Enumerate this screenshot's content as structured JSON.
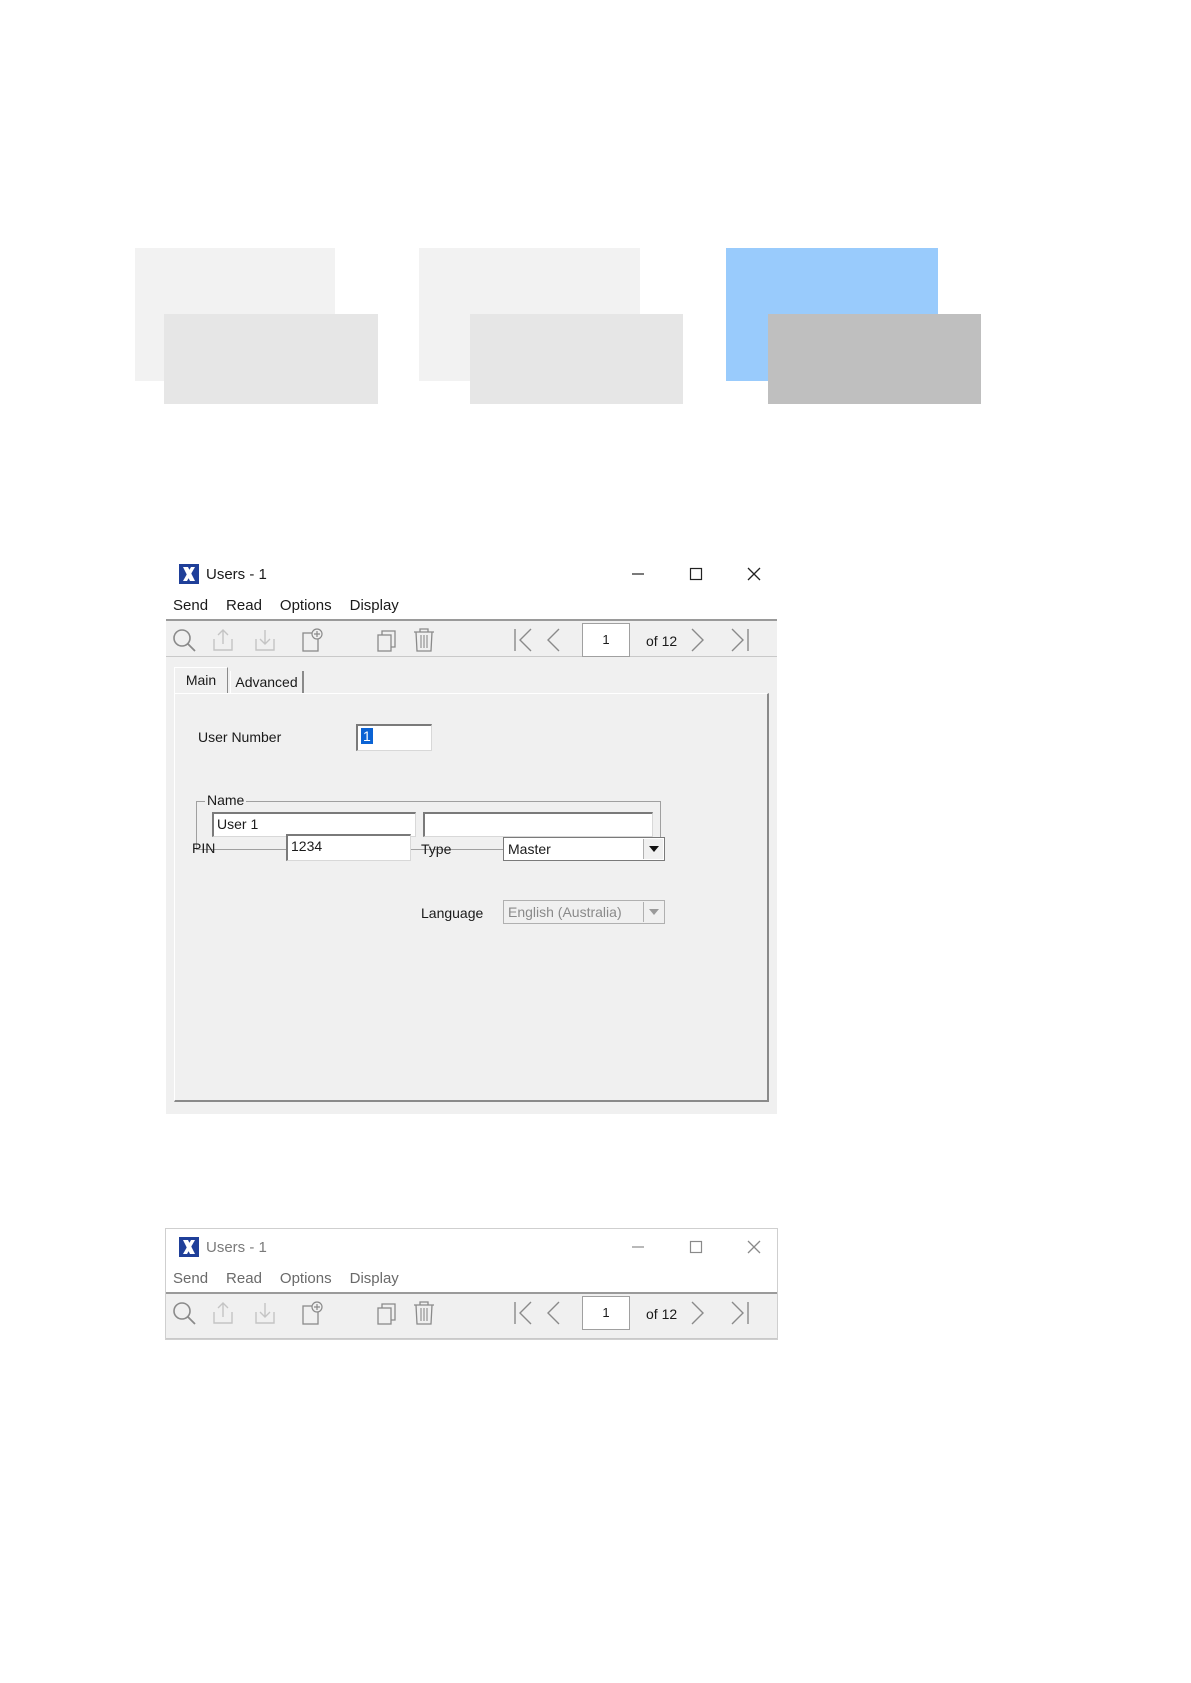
{
  "window": {
    "title": "Users - 1",
    "menu": [
      "Send",
      "Read",
      "Options",
      "Display"
    ],
    "pager": {
      "current": "1",
      "of_label": "of 12"
    }
  },
  "tabs": {
    "main": "Main",
    "advanced": "Advanced"
  },
  "form": {
    "user_number_label": "User Number",
    "user_number_value": "1",
    "name_group_label": "Name",
    "name_first": "User 1",
    "name_second": "",
    "pin_label": "PIN",
    "pin_value": "1234",
    "type_label": "Type",
    "type_value": "Master",
    "language_label": "Language",
    "language_value": "English (Australia)"
  },
  "icons": {
    "search": "search-icon",
    "upload": "send-icon",
    "download": "read-icon",
    "new": "new-record-icon",
    "copy": "copy-icon",
    "delete": "trash-icon",
    "first": "first-page-icon",
    "prev": "prev-page-icon",
    "next": "next-page-icon",
    "last": "last-page-icon"
  },
  "colors": {
    "accent_block": "#99cbfc",
    "selection": "#0b63d4",
    "app_icon": "#1f3f99"
  }
}
